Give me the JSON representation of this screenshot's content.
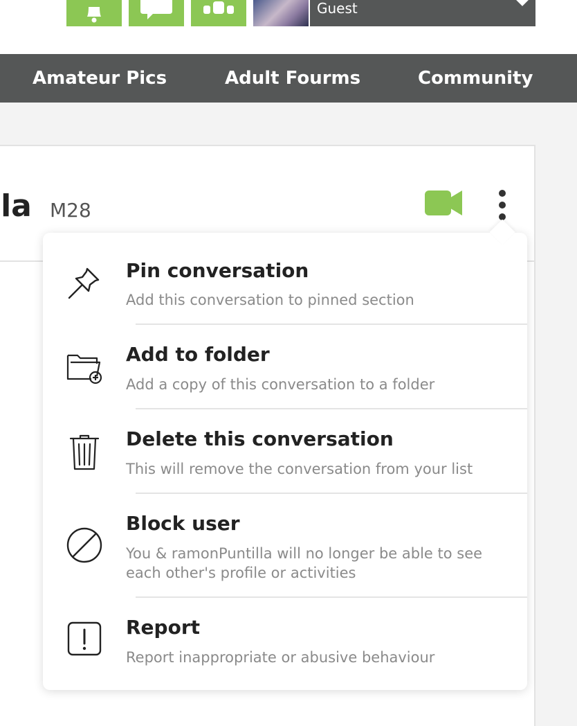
{
  "header": {
    "icons": [
      "bell-icon",
      "chat-bubble-icon",
      "community-icon"
    ],
    "user": {
      "name": "Guest"
    }
  },
  "nav": {
    "items": [
      {
        "label": "Amateur Pics"
      },
      {
        "label": "Adult Fourms"
      },
      {
        "label": "Community"
      }
    ]
  },
  "conversation": {
    "name_partial": "lla",
    "tag": "M28"
  },
  "menu": {
    "items": [
      {
        "icon": "pushpin-icon",
        "title": "Pin conversation",
        "subtitle": "Add this conversation to pinned section"
      },
      {
        "icon": "folder-add-icon",
        "title": "Add to folder",
        "subtitle": "Add a copy of this conversation to a folder"
      },
      {
        "icon": "trash-icon",
        "title": "Delete this conversation",
        "subtitle": "This will remove the conversation from your list"
      },
      {
        "icon": "block-icon",
        "title": "Block user",
        "subtitle": "You & ramonPuntilla will no longer be able to see each other's profile or activities"
      },
      {
        "icon": "report-icon",
        "title": "Report",
        "subtitle": "Report inappropriate or abusive behaviour"
      }
    ]
  },
  "colors": {
    "accent_green": "#8cc754",
    "nav_bg": "#555757",
    "text_dark": "#222222",
    "text_muted": "#8a8a8a"
  }
}
